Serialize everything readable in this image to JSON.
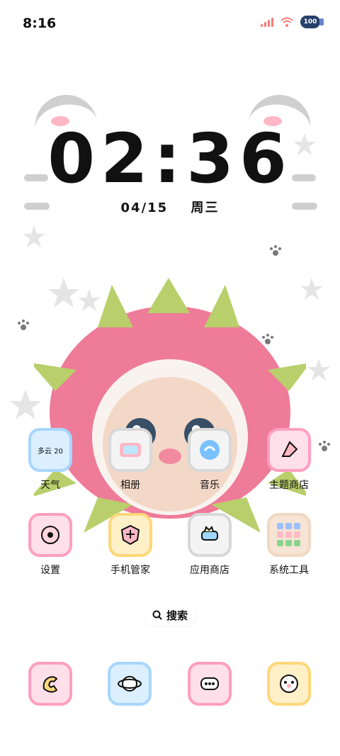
{
  "status_bar": {
    "time": "8:16",
    "battery": "100"
  },
  "lockscreen": {
    "clock": "02:36",
    "date": "04/15",
    "weekday": "周三"
  },
  "apps": [
    {
      "label": "天气",
      "icon": "weather-icon",
      "badge_text": "多云 20"
    },
    {
      "label": "相册",
      "icon": "gallery-icon"
    },
    {
      "label": "音乐",
      "icon": "music-icon"
    },
    {
      "label": "主题商店",
      "icon": "theme-store-icon"
    },
    {
      "label": "设置",
      "icon": "settings-icon"
    },
    {
      "label": "手机管家",
      "icon": "phone-manager-icon"
    },
    {
      "label": "应用商店",
      "icon": "app-store-icon"
    },
    {
      "label": "系统工具",
      "icon": "system-tools-folder-icon"
    }
  ],
  "search": {
    "label": "搜索"
  },
  "dock": [
    {
      "icon": "dock-phone-icon"
    },
    {
      "icon": "dock-browser-icon"
    },
    {
      "icon": "dock-messages-icon"
    },
    {
      "icon": "dock-camera-icon"
    }
  ],
  "colors": {
    "pink_border": "#ff9fbf",
    "blue_border": "#a8d6ff",
    "yellow_border": "#ffd77a",
    "gray_border": "#d8d8d8"
  }
}
